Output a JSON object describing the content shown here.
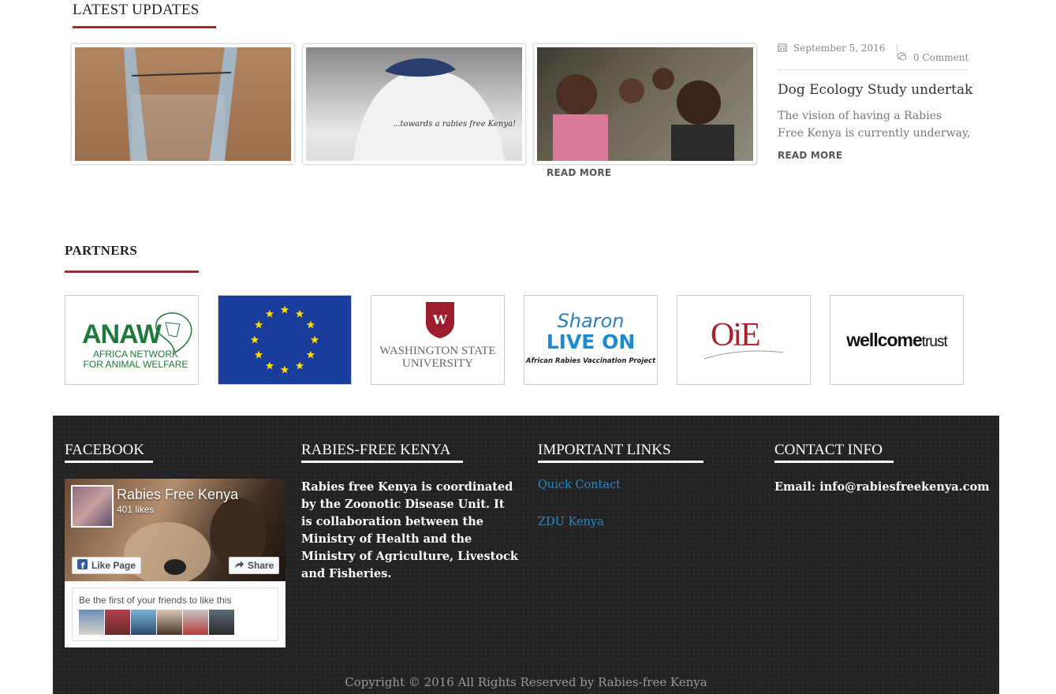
{
  "latest": {
    "title": "LATEST UPDATES",
    "read_more_label": "READ MORE",
    "featured": {
      "date": "September 5, 2016",
      "comments": "0 Comment",
      "title": "Dog Ecology Study undertak",
      "excerpt": "The vision of having a Rabies Free Kenya is currently underway, w",
      "read_more_label": "READ MORE"
    }
  },
  "partners": {
    "title": "PARTNERS",
    "items": [
      {
        "name": "anaw",
        "line1": "ANAW",
        "line2": "AFRICA NETWORK",
        "line3": "FOR ANIMAL WELFARE"
      },
      {
        "name": "eu"
      },
      {
        "name": "wsu",
        "line1": "WASHINGTON STATE",
        "line2": "UNIVERSITY"
      },
      {
        "name": "sharon",
        "line1": "Sharon",
        "line2": "LIVE ON",
        "line3": "African Rabies Vaccination Project"
      },
      {
        "name": "oie",
        "line1": "OiE"
      },
      {
        "name": "wellcome",
        "line1": "wellcome",
        "line2": "trust"
      }
    ]
  },
  "footer": {
    "facebook": {
      "title": "FACEBOOK",
      "page_name": "Rabies Free Kenya",
      "likes": "401 likes",
      "like_label": "Like Page",
      "share_label": "Share",
      "friends_text": "Be the first of your friends to like this"
    },
    "about": {
      "title": "RABIES-FREE KENYA",
      "text": "Rabies free Kenya is coordinated by the Zoonotic Disease Unit. It is collaboration between the Ministry of Health and the Ministry of Agriculture, Livestock and Fisheries."
    },
    "links": {
      "title": "IMPORTANT LINKS",
      "items": [
        "Quick Contact",
        "ZDU Kenya"
      ]
    },
    "contact": {
      "title": "CONTACT INFO",
      "email": "Email: info@rabiesfreekenya.com"
    },
    "copyright": "Copyright © 2016 All Rights Reserved by Rabies-free Kenya"
  },
  "colors": {
    "accent": "#a8282d",
    "footer_bg": "#232323",
    "link": "#2a88c9"
  }
}
